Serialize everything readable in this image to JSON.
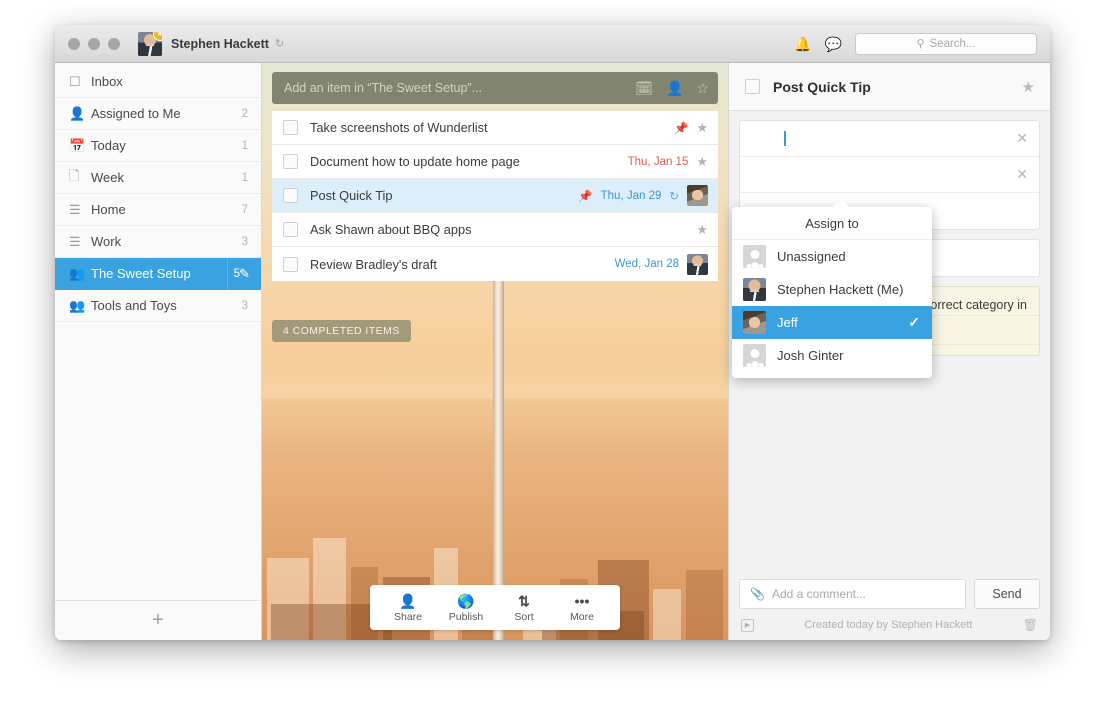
{
  "titlebar": {
    "user_name": "Stephen Hackett",
    "sync_icon": "↻",
    "bell_icon": " ",
    "chat_icon": " ",
    "search_icon": "⌕",
    "search_placeholder": "Search..."
  },
  "sidebar": {
    "items": [
      {
        "label": "Inbox",
        "count": "",
        "icon": "inbox"
      },
      {
        "label": "Assigned to Me",
        "count": "2",
        "icon": "assigned"
      },
      {
        "label": "Today",
        "count": "1",
        "icon": "calendar"
      },
      {
        "label": "Week",
        "count": "1",
        "icon": "week"
      },
      {
        "label": "Home",
        "count": "7",
        "icon": "list"
      },
      {
        "label": "Work",
        "count": "3",
        "icon": "list"
      },
      {
        "label": "The Sweet Setup",
        "count": "5",
        "icon": "people"
      },
      {
        "label": "Tools and Toys",
        "count": "3",
        "icon": "people"
      }
    ],
    "active_index": 6,
    "edit_icon": "✎",
    "add_list_label": "+"
  },
  "list_pane": {
    "add_item_placeholder": "Add an item in “The Sweet Setup”...",
    "add_icons": [
      "calendar-icon",
      "assign-person-icon",
      "star-icon"
    ],
    "tasks": [
      {
        "title": "Take screenshots of Wunderlist",
        "date": "",
        "date_color": "",
        "pinned": true,
        "recurring": false,
        "avatar": "",
        "selected": false
      },
      {
        "title": "Document how to update home page",
        "date": "Thu, Jan 15",
        "date_color": "red",
        "pinned": false,
        "recurring": false,
        "avatar": "",
        "selected": false
      },
      {
        "title": "Post Quick Tip",
        "date": "Thu, Jan 29",
        "date_color": "blue",
        "pinned": true,
        "recurring": true,
        "avatar": "jeff",
        "selected": true
      },
      {
        "title": "Ask Shawn about BBQ apps",
        "date": "",
        "date_color": "",
        "pinned": false,
        "recurring": false,
        "avatar": "",
        "selected": false
      },
      {
        "title": "Review Bradley's draft",
        "date": "Wed, Jan 28",
        "date_color": "blue",
        "pinned": false,
        "recurring": false,
        "avatar": "steve",
        "selected": false
      }
    ],
    "completed_badge": "4 COMPLETED ITEMS",
    "toolbar": [
      {
        "label": "Share",
        "icon": "share-person-icon"
      },
      {
        "label": "Publish",
        "icon": "globe-icon"
      },
      {
        "label": "Sort",
        "icon": "sort-az-icon"
      },
      {
        "label": "More",
        "icon": "ellipsis-icon"
      }
    ]
  },
  "detail": {
    "title": "Post Quick Tip",
    "star_icon": "★",
    "rows": [
      {
        "type": "assignee",
        "avatar": "jeff",
        "text": "",
        "close": "✕"
      },
      {
        "type": "due-date",
        "text": "",
        "close": "✕"
      },
      {
        "type": "reminder",
        "text": "",
        "close": ""
      },
      {
        "type": "subtask",
        "text": "",
        "close": ""
      }
    ],
    "note_text": "e correct category in",
    "comment_placeholder": "Add a comment...",
    "send_label": "Send",
    "meta_text": "Created today by Stephen Hackett",
    "trash_icon": "🗑",
    "activity_icon": "▶"
  },
  "assign_popover": {
    "title": "Assign to",
    "items": [
      {
        "label": "Unassigned",
        "avatar": "placeholder",
        "selected": false
      },
      {
        "label": "Stephen Hackett (Me)",
        "avatar": "steve",
        "selected": false
      },
      {
        "label": "Jeff",
        "avatar": "jeff",
        "selected": true
      },
      {
        "label": "Josh Ginter",
        "avatar": "placeholder",
        "selected": false
      }
    ],
    "check_icon": "✓"
  },
  "colors": {
    "accent": "#3aa2e0",
    "overdue": "#e05a4e",
    "due": "#3a96d4",
    "note_bg": "#f8f6e3"
  }
}
